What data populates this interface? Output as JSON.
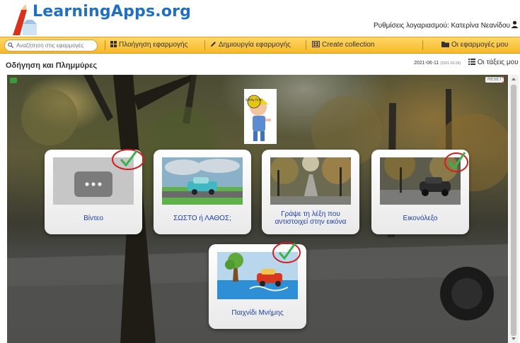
{
  "header": {
    "logo_text": "LearningApps.org",
    "account_label": "Ρυθμίσεις λογαριασμού: Κατερίνα Νεανίδου"
  },
  "navbar": {
    "search_placeholder": "Αναζήτηση στις εφαρμογές",
    "items": [
      {
        "label": "Πλοήγηση εφαρμογής",
        "icon": "grid-icon"
      },
      {
        "label": "Δημιουργία εφαρμογής",
        "icon": "pencil-icon"
      },
      {
        "label": "Create collection",
        "icon": "collection-icon"
      },
      {
        "label": "Οι εφαρμογές μου",
        "icon": "folder-icon"
      }
    ]
  },
  "titlebar": {
    "title": "Οδήγηση και Πλημμύρες",
    "date": "2021-06-11",
    "date_small": "(2021-03-26)",
    "classes_label": "Οι τάξεις μου"
  },
  "stage": {
    "reset_label": "RESET",
    "mascot_text": "Safety First!",
    "cards": [
      {
        "label": "Βίντεο",
        "thumb": "video-placeholder",
        "checked": true
      },
      {
        "label": "ΣΩΣΤΟ ή ΛΑΘΟΣ;",
        "thumb": "car-flood-cartoon",
        "checked": false
      },
      {
        "label": "Γράψε τη λέξη που αντιστοιχεί στην εικόνα",
        "thumb": "flooded-road-photo",
        "checked": false
      },
      {
        "label": "Εικονόλεξο",
        "thumb": "car-street-photo",
        "checked": true
      },
      {
        "label": "Παιχνίδι Μνήμης",
        "thumb": "flood-car-illustration",
        "checked": true
      }
    ]
  },
  "colors": {
    "brand_blue": "#1f6fc5",
    "navbar_yellow": "#f7b928",
    "card_label_blue": "#1b3fb0",
    "check_green": "#3bb24a",
    "check_circle_red": "#d21f1f"
  }
}
